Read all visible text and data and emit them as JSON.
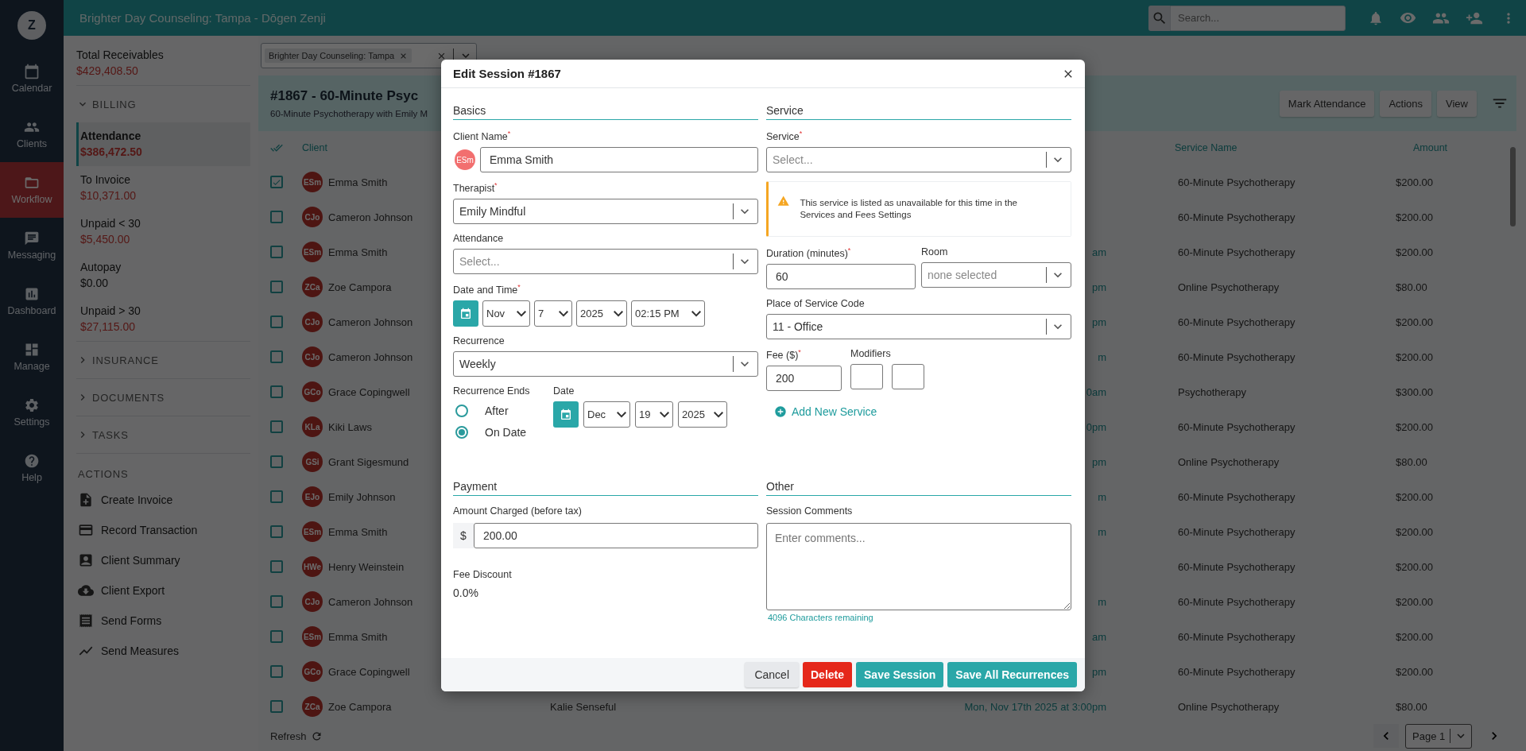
{
  "nav": {
    "logo": "Z",
    "items": [
      {
        "label": "Calendar",
        "selected": false
      },
      {
        "label": "Clients",
        "selected": false
      },
      {
        "label": "Workflow",
        "selected": true
      },
      {
        "label": "Messaging",
        "selected": false
      },
      {
        "label": "Dashboard",
        "selected": false
      },
      {
        "label": "Manage",
        "selected": false
      },
      {
        "label": "Settings",
        "selected": false
      },
      {
        "label": "Help",
        "selected": false
      }
    ]
  },
  "topbar": {
    "title": "Brighter Day Counseling: Tampa - Dōgen Zenji",
    "search": {
      "placeholder": "Search..."
    }
  },
  "sidebar": {
    "total": {
      "label": "Total Receivables",
      "amount": "$429,408.50"
    },
    "sections": [
      {
        "title": "BILLING",
        "expanded": true,
        "items": [
          {
            "label": "Attendance",
            "amount": "$386,472.50",
            "selected": true,
            "highlight": true
          },
          {
            "label": "To Invoice",
            "amount": "$10,371.00",
            "selected": false,
            "highlight": true
          },
          {
            "label": "Unpaid < 30",
            "amount": "$5,450.00",
            "selected": false,
            "highlight": true
          },
          {
            "label": "Autopay",
            "amount": "$0.00",
            "selected": false,
            "highlight": false
          },
          {
            "label": "Unpaid > 30",
            "amount": "$27,115.00",
            "selected": false,
            "highlight": true
          }
        ]
      },
      {
        "title": "INSURANCE",
        "expanded": false
      },
      {
        "title": "DOCUMENTS",
        "expanded": false
      },
      {
        "title": "TASKS",
        "expanded": false
      }
    ],
    "actions": {
      "title": "ACTIONS",
      "items": [
        "Create Invoice",
        "Record Transaction",
        "Client Summary",
        "Client Export",
        "Send Forms",
        "Send Measures"
      ]
    }
  },
  "main": {
    "filter": {
      "tag": "Brighter Day Counseling: Tampa"
    },
    "header": {
      "title": "#1867 - 60-Minute Psyc",
      "subtitle": "60-Minute Psychotherapy with Emily M",
      "buttons": [
        "Mark Attendance",
        "Actions",
        "View"
      ]
    },
    "table": {
      "columns": {
        "client": "Client",
        "service": "Service Name",
        "amount": "Amount"
      },
      "rows": [
        {
          "checked": true,
          "initials": "ESm",
          "client": "Emma Smith",
          "service": "60-Minute Psychotherapy",
          "amount": "$200.00"
        },
        {
          "checked": false,
          "initials": "CJo",
          "client": "Cameron Johnson",
          "service": "60-Minute Psychotherapy",
          "amount": "$200.00"
        },
        {
          "checked": false,
          "initials": "ESm",
          "client": "Emma Smith",
          "date": "am",
          "service": "60-Minute Psychotherapy",
          "amount": "$200.00"
        },
        {
          "checked": false,
          "initials": "ZCa",
          "client": "Zoe Campora",
          "date": "pm",
          "service": "Online Psychotherapy",
          "amount": "$80.00"
        },
        {
          "checked": false,
          "initials": "CJo",
          "client": "Cameron Johnson",
          "date": "pm",
          "service": "60-Minute Psychotherapy",
          "amount": "$200.00"
        },
        {
          "checked": false,
          "initials": "CJo",
          "client": "Cameron Johnson",
          "date": "m",
          "service": "60-Minute Psychotherapy",
          "amount": "$200.00"
        },
        {
          "checked": false,
          "initials": "GCo",
          "client": "Grace Copingwell",
          "date": "0am",
          "service": "Psychotherapy",
          "amount": "$300.00"
        },
        {
          "checked": false,
          "initials": "KLa",
          "client": "Kiki Laws",
          "date": "0pm",
          "service": "60-Minute Psychotherapy",
          "amount": "$200.00"
        },
        {
          "checked": false,
          "initials": "GSi",
          "client": "Grant Sigesmund",
          "date": "pm",
          "service": "Online Psychotherapy",
          "amount": "$80.00"
        },
        {
          "checked": false,
          "initials": "EJo",
          "client": "Emily Johnson",
          "date": "m",
          "service": "60-Minute Psychotherapy",
          "amount": "$200.00"
        },
        {
          "checked": false,
          "initials": "ESm",
          "client": "Emma Smith",
          "date": "m",
          "service": "60-Minute Psychotherapy",
          "amount": "$200.00"
        },
        {
          "checked": false,
          "initials": "HWe",
          "client": "Henry Weinstein",
          "service": "60-Minute Psychotherapy",
          "amount": "$200.00"
        },
        {
          "checked": false,
          "initials": "CJo",
          "client": "Cameron Johnson",
          "date": "m",
          "service": "60-Minute Psychotherapy",
          "amount": "$200.00"
        },
        {
          "checked": false,
          "initials": "ESm",
          "client": "Emma Smith",
          "date": "am",
          "service": "60-Minute Psychotherapy",
          "amount": "$200.00"
        },
        {
          "checked": false,
          "initials": "GCo",
          "client": "Grace Copingwell",
          "date": "pm",
          "service": "60-Minute Psychotherapy",
          "amount": "$200.00"
        },
        {
          "checked": false,
          "initials": "ZCa",
          "client": "Zoe Campora",
          "clinician": "Kalie Senseful",
          "date": "Mon, Nov 17th 2025 at 3:00pm",
          "service": "Online Psychotherapy",
          "amount": "$80.00"
        }
      ]
    },
    "footer": {
      "refresh": "Refresh",
      "page": "Page 1"
    }
  },
  "modal": {
    "title": "Edit Session #1867",
    "basics": {
      "title": "Basics",
      "client_name": {
        "label": "Client Name$^{*}$",
        "initials": "ESm",
        "value": "Emma Smith"
      },
      "therapist": {
        "label": "Therapist$^{*}$",
        "value": "Emily Mindful"
      },
      "attendance": {
        "label": "Attendance",
        "placeholder": "Select..."
      },
      "date_time": {
        "label": "Date and Time$^{*}$",
        "parts": [
          "Nov",
          "7",
          "2025",
          "02:15 PM"
        ]
      },
      "recurrence": {
        "label": "Recurrence",
        "value": "Weekly"
      },
      "recurrence_ends": {
        "label": "Recurrence Ends",
        "options": [
          {
            "label": "After",
            "selected": false
          },
          {
            "label": "On Date",
            "selected": true
          }
        ]
      },
      "end_date": {
        "label": "Date",
        "parts": [
          "Dec",
          "19",
          "2025"
        ]
      }
    },
    "service": {
      "title": "Service",
      "service": {
        "label": "Service$^{*}$",
        "placeholder": "Select..."
      },
      "warning": "This service is listed as unavailable for this time in the Services and Fees Settings",
      "duration": {
        "label": "Duration (minutes)$^{*}$",
        "value": "60"
      },
      "room": {
        "label": "Room",
        "placeholder": "none selected"
      },
      "place_of_service": {
        "label": "Place of Service Code",
        "value": "11 - Office"
      },
      "fee": {
        "label": "Fee ($)$^{*}$",
        "value": "200"
      },
      "modifiers": {
        "label": "Modifiers"
      },
      "add_service": "Add New Service"
    },
    "payment": {
      "title": "Payment",
      "amount": {
        "label": "Amount Charged (before tax)",
        "prefix": "$",
        "value": "200.00"
      },
      "discount": {
        "label": "Fee Discount",
        "value": "0.0%"
      }
    },
    "other": {
      "title": "Other",
      "comments": {
        "label": "Session Comments",
        "placeholder": "Enter comments...",
        "remaining": "4096 Characters remaining"
      }
    },
    "buttons": [
      {
        "label": "Cancel",
        "kind": "neutral"
      },
      {
        "label": "Delete",
        "kind": "danger"
      },
      {
        "label": "Save Session",
        "kind": "primary"
      },
      {
        "label": "Save All Recurrences",
        "kind": "primary"
      }
    ]
  }
}
